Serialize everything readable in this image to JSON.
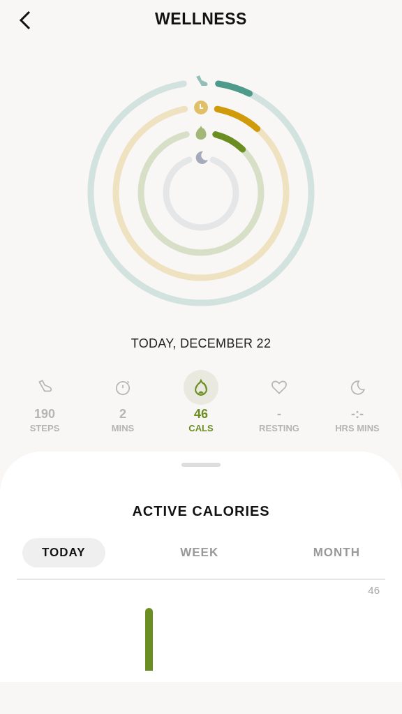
{
  "header": {
    "title": "WELLNESS"
  },
  "rings": [
    {
      "kind": "steps",
      "color": "#4e9b8c"
    },
    {
      "kind": "minutes",
      "color": "#d09a0a"
    },
    {
      "kind": "calories",
      "color": "#6b8e23"
    },
    {
      "kind": "sleep",
      "color": "#a6abbb"
    }
  ],
  "date": "TODAY, DECEMBER 22",
  "stats": [
    {
      "kind": "steps",
      "value": "190",
      "label": "STEPS",
      "selected": false
    },
    {
      "kind": "minutes",
      "value": "2",
      "label": "MINS",
      "selected": false
    },
    {
      "kind": "calories",
      "value": "46",
      "label": "CALS",
      "selected": true
    },
    {
      "kind": "heart",
      "value": "-",
      "label": "RESTING",
      "selected": false
    },
    {
      "kind": "sleep",
      "value": "-:-",
      "label": "HRS MINS",
      "selected": false
    }
  ],
  "sheet": {
    "title": "ACTIVE CALORIES",
    "tabs": [
      {
        "label": "TODAY",
        "selected": true
      },
      {
        "label": "WEEK",
        "selected": false
      },
      {
        "label": "MONTH",
        "selected": false
      }
    ],
    "axis_label": "46"
  }
}
